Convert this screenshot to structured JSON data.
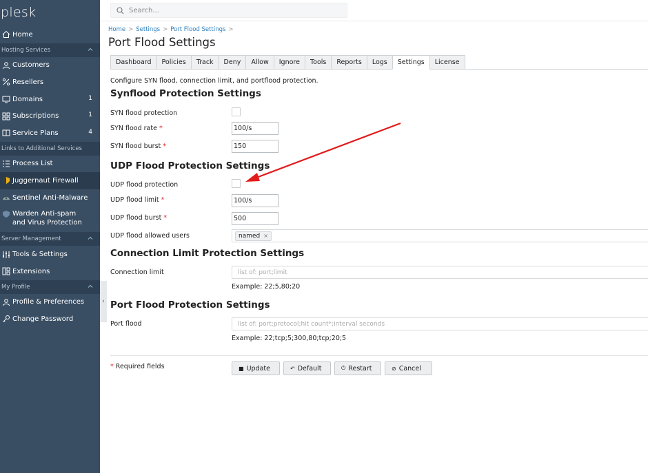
{
  "app": {
    "logo": "plesk"
  },
  "search": {
    "placeholder": "Search..."
  },
  "sidebar": {
    "home": "Home",
    "sections": [
      {
        "title": "Hosting Services"
      },
      {
        "title": "Links to Additional Services"
      },
      {
        "title": "Server Management"
      },
      {
        "title": "My Profile"
      }
    ],
    "items": {
      "customers": "Customers",
      "resellers": "Resellers",
      "domains": {
        "label": "Domains",
        "count": "1"
      },
      "subscriptions": {
        "label": "Subscriptions",
        "count": "1"
      },
      "service_plans": {
        "label": "Service Plans",
        "count": "4"
      },
      "process_list": "Process List",
      "juggernaut": "Juggernaut Firewall",
      "sentinel": "Sentinel Anti-Malware",
      "warden": "Warden Anti-spam and Virus Protection",
      "tools": "Tools & Settings",
      "extensions": "Extensions",
      "profile": "Profile & Preferences",
      "password": "Change Password"
    }
  },
  "breadcrumb": [
    "Home",
    "Settings",
    "Port Flood Settings"
  ],
  "page_title": "Port Flood Settings",
  "tabs": [
    "Dashboard",
    "Policies",
    "Track",
    "Deny",
    "Allow",
    "Ignore",
    "Tools",
    "Reports",
    "Logs",
    "Settings",
    "License"
  ],
  "active_tab": "Settings",
  "description": "Configure SYN flood, connection limit, and portflood protection.",
  "syn": {
    "title": "Synflood Protection Settings",
    "protection_label": "SYN flood protection",
    "rate_label": "SYN flood rate",
    "rate_value": "100/s",
    "burst_label": "SYN flood burst",
    "burst_value": "150"
  },
  "udp": {
    "title": "UDP Flood Protection Settings",
    "protection_label": "UDP flood protection",
    "limit_label": "UDP flood limit",
    "limit_value": "100/s",
    "burst_label": "UDP flood burst",
    "burst_value": "500",
    "users_label": "UDP flood allowed users",
    "users_tag": "named",
    "tag_remove": "×"
  },
  "connection": {
    "title": "Connection Limit Protection Settings",
    "label": "Connection limit",
    "placeholder": "list of: port;limit",
    "example": "Example: 22;5,80;20"
  },
  "portflood": {
    "title": "Port Flood Protection Settings",
    "label": "Port flood",
    "placeholder": "list of: port;protocol;hit count*;interval seconds",
    "example": "Example: 22;tcp;5;300,80;tcp;20;5"
  },
  "required_note": "Required fields",
  "required_mark": "*",
  "buttons": {
    "update": "Update",
    "default": "Default",
    "restart": "Restart",
    "cancel": "Cancel"
  },
  "colors": {
    "sidebar": "#3a4e63",
    "link": "#2a7fc1",
    "arrow": "#e21b1b",
    "required": "#dd2222"
  }
}
